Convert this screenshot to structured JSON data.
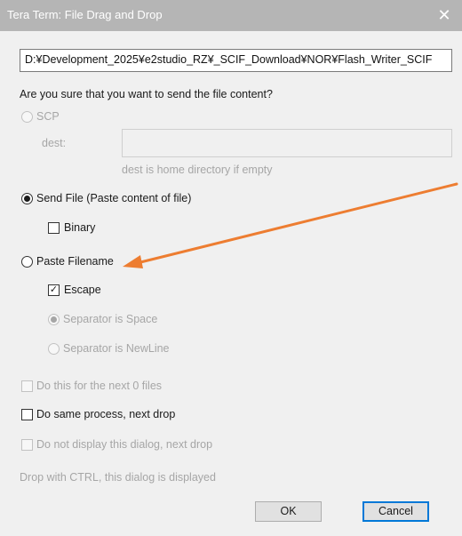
{
  "window": {
    "title": "Tera Term: File Drag and Drop",
    "close_symbol": "✕"
  },
  "path": {
    "value": "D:¥Development_2025¥e2studio_RZ¥_SCIF_Download¥NOR¥Flash_Writer_SCIF"
  },
  "prompt": "Are you sure that you want to send the file content?",
  "scp": {
    "label": "SCP",
    "dest_label": "dest:",
    "dest_value": "",
    "dest_hint": "dest is home directory if empty"
  },
  "send_file": {
    "label": "Send File (Paste content of file)",
    "binary_label": "Binary",
    "binary_checked": false
  },
  "paste_filename": {
    "label": "Paste Filename",
    "escape_label": "Escape",
    "escape_checked": true,
    "sep_space_label": "Separator is Space",
    "sep_newline_label": "Separator is NewLine"
  },
  "options": {
    "next_files_label": "Do this for the next 0 files",
    "same_process_label": "Do same process, next drop",
    "no_display_label": "Do not display this dialog, next drop",
    "ctrl_hint": "Drop with CTRL, this dialog is displayed"
  },
  "buttons": {
    "ok": "OK",
    "cancel": "Cancel"
  },
  "colors": {
    "annotation_arrow": "#ed7d31",
    "default_button_border": "#0078d7",
    "titlebar": "#b5b5b5"
  },
  "icons": {
    "close": "close-icon",
    "checkmark": "checkmark-icon",
    "arrow": "annotation-arrow"
  }
}
